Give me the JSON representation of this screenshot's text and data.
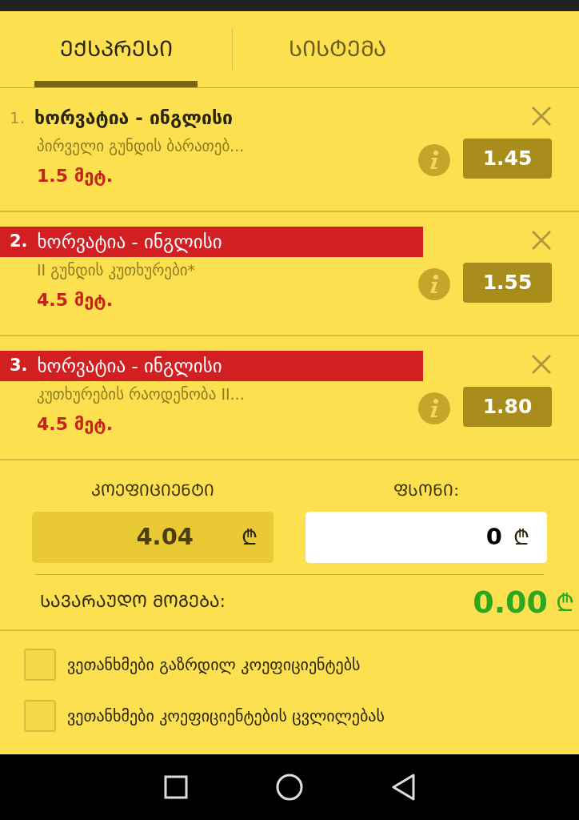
{
  "tabs": [
    {
      "label": "ᲔᲥᲡᲞᲠᲔᲡᲘ",
      "selected": true
    },
    {
      "label": "ᲡᲘᲡᲢᲔᲛᲐ",
      "selected": false
    }
  ],
  "bets": [
    {
      "number": "1.",
      "match": "ხორვატია - ინგლისი",
      "market": "პირველი გუნდის ბარათებ...",
      "outcome": "1.5 მეტ.",
      "odds": "1.45",
      "highlighted": false
    },
    {
      "number": "2.",
      "match": "ხორვატია - ინგლისი",
      "market": "II გუნდის კუთხურები*",
      "outcome": "4.5 მეტ.",
      "odds": "1.55",
      "highlighted": true
    },
    {
      "number": "3.",
      "match": "ხორვატია - ინგლისი",
      "market": "კუთხურების რაოდენობა II...",
      "outcome": "4.5 მეტ.",
      "odds": "1.80",
      "highlighted": true
    }
  ],
  "coefficient": {
    "label": "ᲙᲝᲔᲤᲘᲪᲘᲔᲜᲢᲘ",
    "value": "4.04",
    "currency": "₾"
  },
  "stake": {
    "label": "ᲤᲡᲝᲜᲘ:",
    "value": "0",
    "currency": "₾"
  },
  "potential_win": {
    "label": "ᲡᲐᲕᲐᲠᲐᲣᲓᲝ ᲛᲝᲒᲔᲑᲐ:",
    "value": "0.00",
    "currency": "₾"
  },
  "agreements": [
    {
      "label": "ვეთანხმები გაზრდილ კოეფიციენტებს",
      "checked": false
    },
    {
      "label": "ვეთანხმები კოეფიციენტების ცვლილებას",
      "checked": false
    }
  ]
}
